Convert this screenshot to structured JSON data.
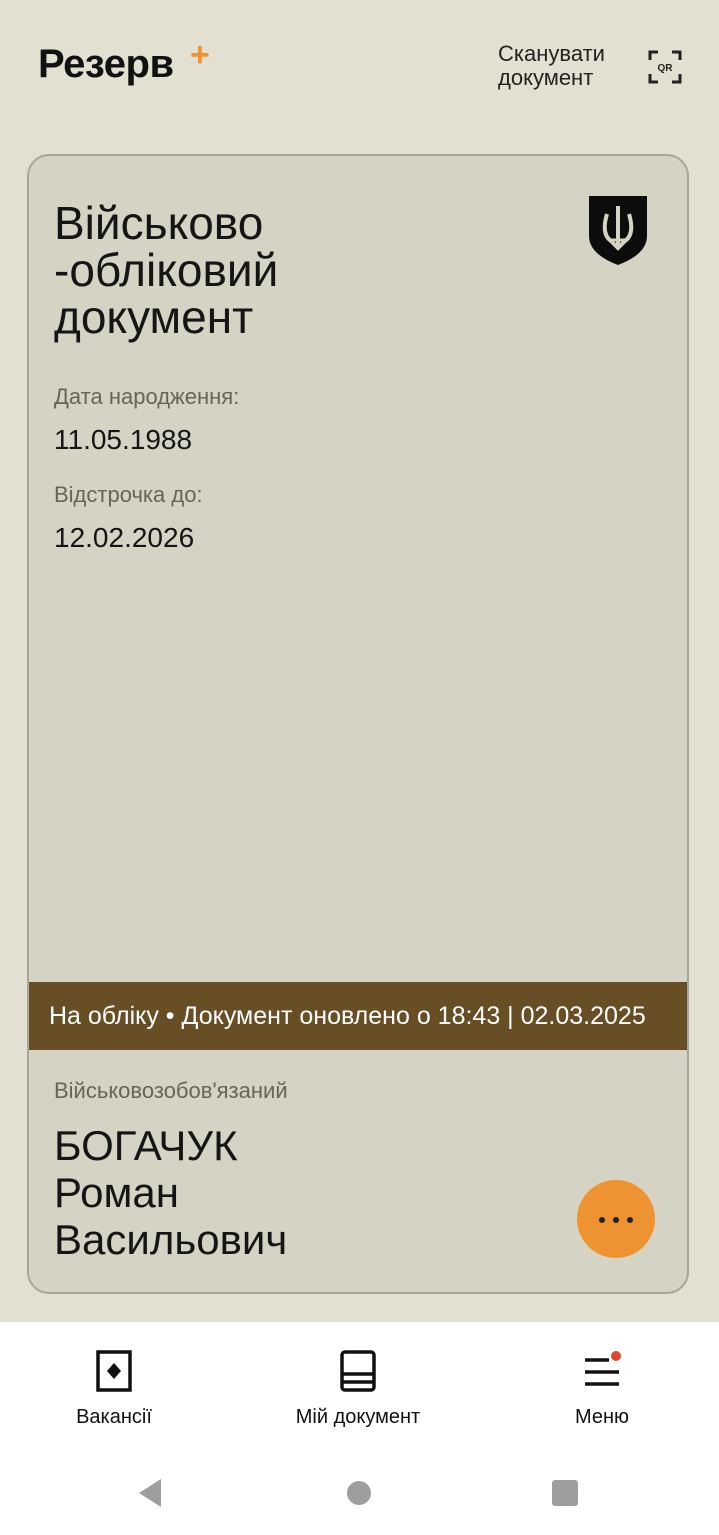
{
  "header": {
    "logo": "Резерв",
    "logo_plus": "+",
    "scan_label": "Сканувати документ",
    "qr_text": "QR"
  },
  "document": {
    "title": "Військово -обліковий документ",
    "birth_label": "Дата народження:",
    "birth_value": "11.05.1988",
    "deferral_label": "Відстрочка до:",
    "deferral_value": "12.02.2026",
    "status_text": "На обліку • Документ оновлено о 18:43 | 02.03.2025",
    "role": "Військовозобов'язаний",
    "name_line1": "БОГАЧУК",
    "name_line2": "Роман",
    "name_line3": "Васильович"
  },
  "nav": {
    "vacancies": "Вакансії",
    "my_document": "Мій документ",
    "menu": "Меню"
  },
  "colors": {
    "background": "#e2e0d0",
    "card": "#d5d3c3",
    "status_bar": "#684e25",
    "accent": "#ef9332",
    "notification_dot": "#e0462c"
  },
  "icons": {
    "scan": "qr-scan-icon",
    "emblem": "trident-emblem-icon",
    "more": "more-dots-icon",
    "vacancies": "vacancies-icon",
    "my_document": "document-icon",
    "menu": "hamburger-menu-icon"
  }
}
